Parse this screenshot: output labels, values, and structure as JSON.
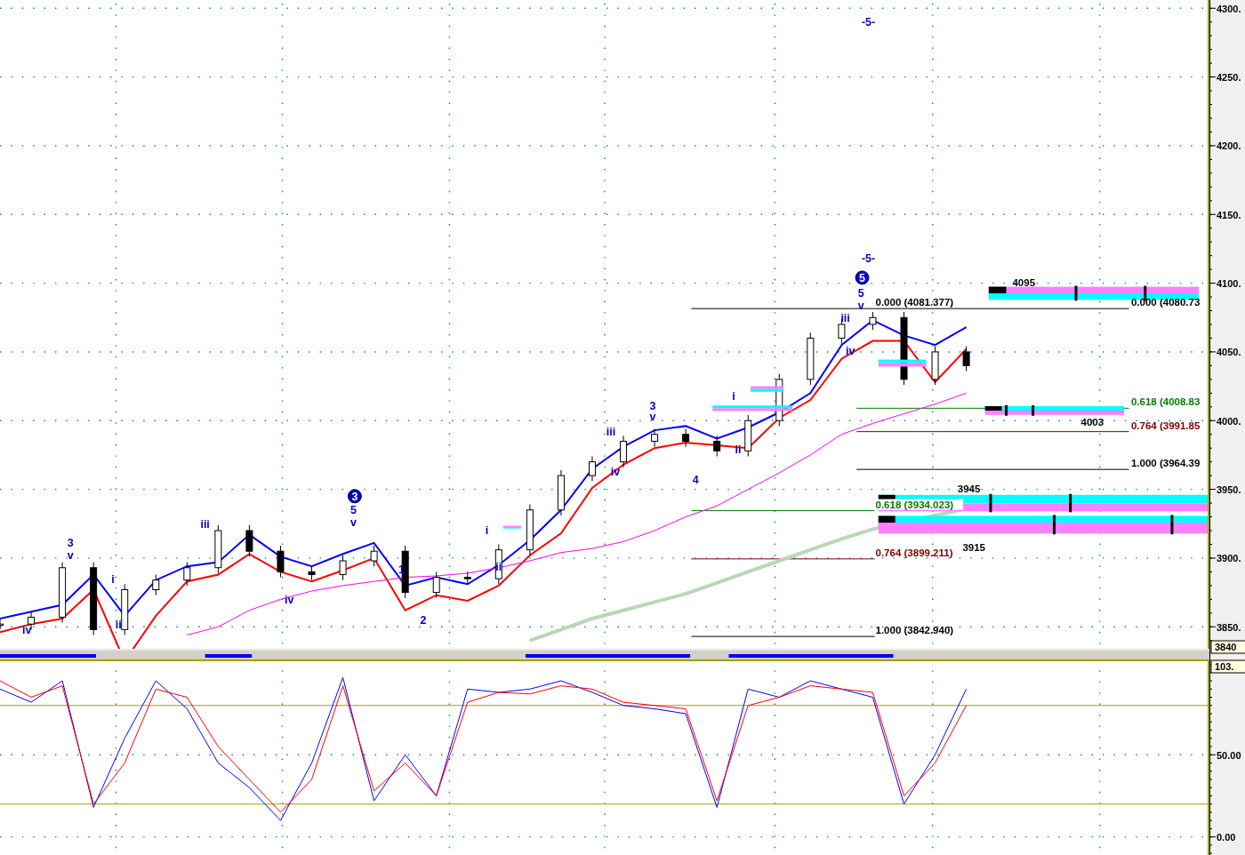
{
  "price_panel": {
    "axis_labels": [
      "4300.",
      "4250.",
      "4200.",
      "4150.",
      "4100.",
      "4050.",
      "4000.",
      "3950.",
      "3900.",
      "3850."
    ],
    "current_value": "3840",
    "zones": [
      {
        "label": "4095"
      },
      {
        "label": "4003"
      },
      {
        "label": "3945"
      },
      {
        "label": "3915"
      }
    ],
    "fib_levels": [
      {
        "label": "0.000 (4081.377)",
        "color": "#000000"
      },
      {
        "label": "0.000 (4080.73",
        "color": "#000000"
      },
      {
        "label": "0.618 (4008.83",
        "color": "#007f00"
      },
      {
        "label": "0.764 (3991.85",
        "color": "#800000"
      },
      {
        "label": "1.000 (3964.39",
        "color": "#000000"
      },
      {
        "label": "0.618 (3934.023)",
        "color": "#007f00"
      },
      {
        "label": "0.764 (3899.211)",
        "color": "#800000"
      },
      {
        "label": "1.000 (3842.940)",
        "color": "#000000"
      }
    ],
    "wave_labels": [
      {
        "text": "-5-",
        "circled": false
      },
      {
        "text": "-5-",
        "circled": false
      },
      {
        "text": "5",
        "circled": true
      },
      {
        "text": "5",
        "circled": false
      },
      {
        "text": "v",
        "circled": false
      },
      {
        "text": "iii",
        "circled": false
      },
      {
        "text": "iv",
        "circled": false
      },
      {
        "text": "3",
        "circled": false
      },
      {
        "text": "v",
        "circled": false
      },
      {
        "text": "iii",
        "circled": false
      },
      {
        "text": "iv",
        "circled": false
      },
      {
        "text": "4",
        "circled": false
      },
      {
        "text": "i",
        "circled": false
      },
      {
        "text": "ii",
        "circled": false
      },
      {
        "text": "3",
        "circled": true
      },
      {
        "text": "5",
        "circled": false
      },
      {
        "text": "v",
        "circled": false
      },
      {
        "text": "iii",
        "circled": false
      },
      {
        "text": "iv",
        "circled": false
      },
      {
        "text": "3",
        "circled": false
      },
      {
        "text": "v",
        "circled": false
      },
      {
        "text": "i",
        "circled": false
      },
      {
        "text": "ii",
        "circled": false
      },
      {
        "text": "iv",
        "circled": false
      },
      {
        "text": "1",
        "circled": false
      },
      {
        "text": "2",
        "circled": false
      },
      {
        "text": "i",
        "circled": false
      },
      {
        "text": "ii",
        "circled": false
      }
    ]
  },
  "oscillator_panel": {
    "axis_labels": [
      "50.00",
      "0.00"
    ],
    "current_value": "103."
  }
}
